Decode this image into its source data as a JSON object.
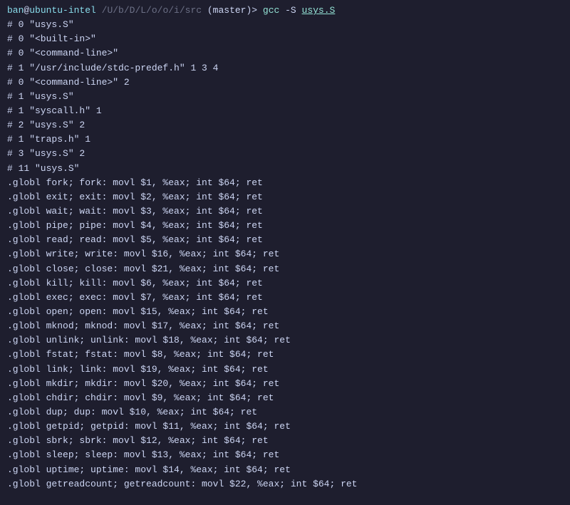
{
  "prompt": {
    "user": "ban",
    "at": "@",
    "host": "ubuntu-intel",
    "path": " /U/b/D/L/o/o/i/src ",
    "branch": "(master)",
    "arrow": "> "
  },
  "command": {
    "gcc": "gcc ",
    "flags": "-S ",
    "file": "usys.S"
  },
  "output": [
    "# 0 \"usys.S\"",
    "# 0 \"<built-in>\"",
    "# 0 \"<command-line>\"",
    "# 1 \"/usr/include/stdc-predef.h\" 1 3 4",
    "# 0 \"<command-line>\" 2",
    "# 1 \"usys.S\"",
    "# 1 \"syscall.h\" 1",
    "# 2 \"usys.S\" 2",
    "# 1 \"traps.h\" 1",
    "# 3 \"usys.S\" 2",
    "# 11 \"usys.S\"",
    ".globl fork; fork: movl $1, %eax; int $64; ret",
    ".globl exit; exit: movl $2, %eax; int $64; ret",
    ".globl wait; wait: movl $3, %eax; int $64; ret",
    ".globl pipe; pipe: movl $4, %eax; int $64; ret",
    ".globl read; read: movl $5, %eax; int $64; ret",
    ".globl write; write: movl $16, %eax; int $64; ret",
    ".globl close; close: movl $21, %eax; int $64; ret",
    ".globl kill; kill: movl $6, %eax; int $64; ret",
    ".globl exec; exec: movl $7, %eax; int $64; ret",
    ".globl open; open: movl $15, %eax; int $64; ret",
    ".globl mknod; mknod: movl $17, %eax; int $64; ret",
    ".globl unlink; unlink: movl $18, %eax; int $64; ret",
    ".globl fstat; fstat: movl $8, %eax; int $64; ret",
    ".globl link; link: movl $19, %eax; int $64; ret",
    ".globl mkdir; mkdir: movl $20, %eax; int $64; ret",
    ".globl chdir; chdir: movl $9, %eax; int $64; ret",
    ".globl dup; dup: movl $10, %eax; int $64; ret",
    ".globl getpid; getpid: movl $11, %eax; int $64; ret",
    ".globl sbrk; sbrk: movl $12, %eax; int $64; ret",
    ".globl sleep; sleep: movl $13, %eax; int $64; ret",
    ".globl uptime; uptime: movl $14, %eax; int $64; ret",
    ".globl getreadcount; getreadcount: movl $22, %eax; int $64; ret"
  ]
}
